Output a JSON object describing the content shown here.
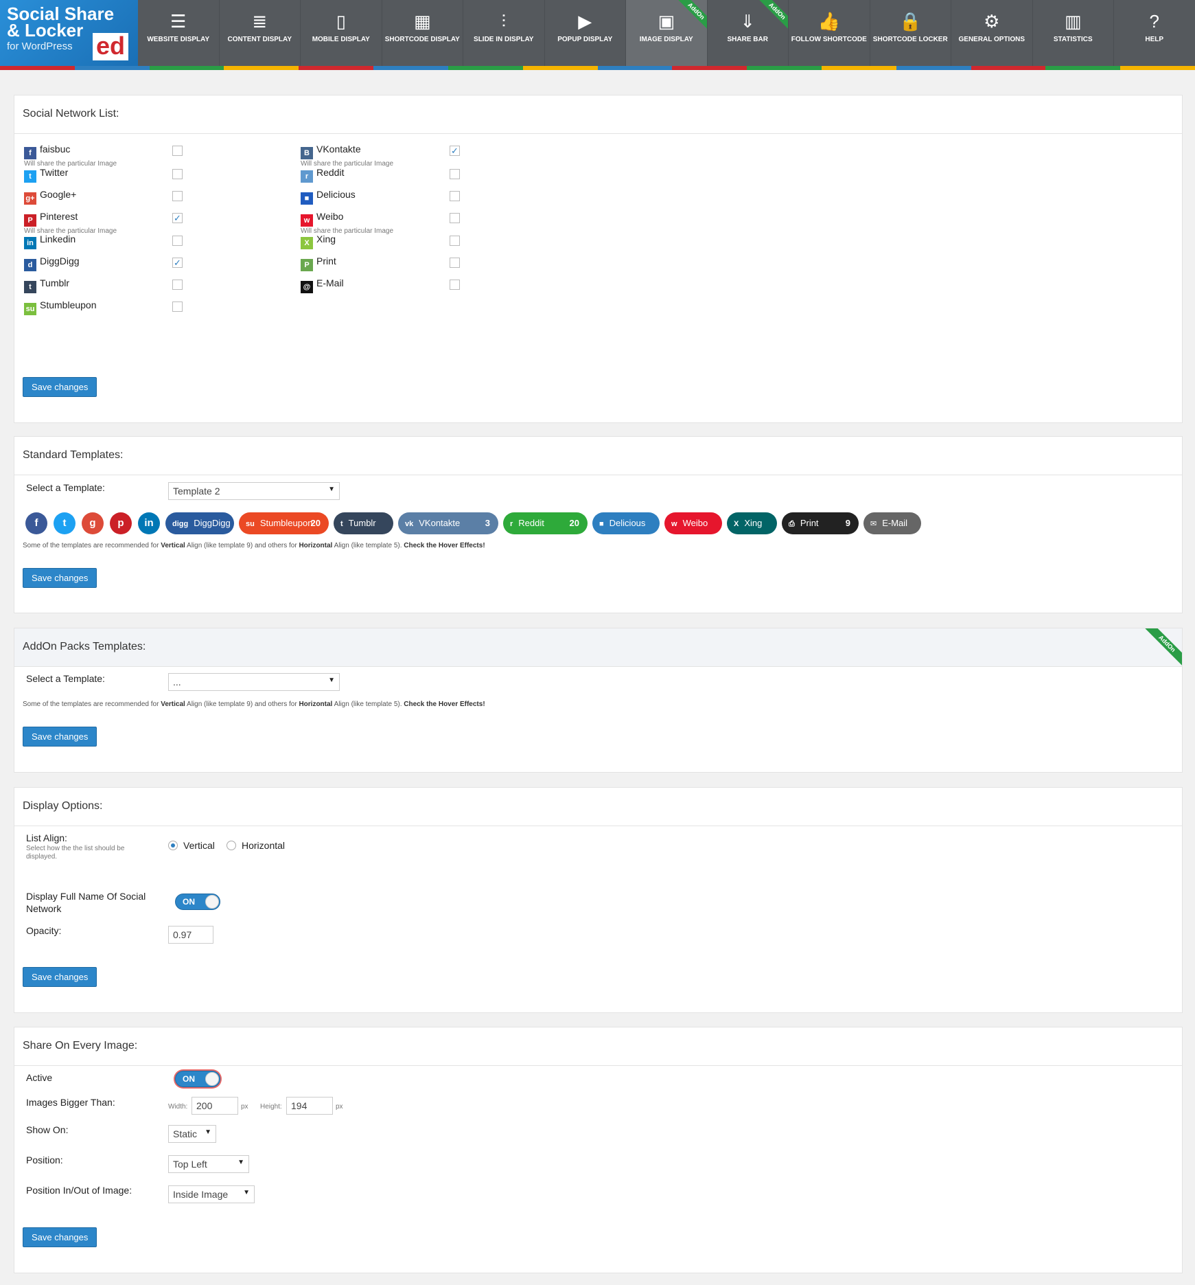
{
  "logo": {
    "line1": "Social Share",
    "line2": "& Locker",
    "line3": "for WordPress",
    "badge": "ed"
  },
  "nav": [
    {
      "icon": "☰",
      "label": "WEBSITE DISPLAY",
      "addon": ""
    },
    {
      "icon": "≣",
      "label": "CONTENT DISPLAY",
      "addon": ""
    },
    {
      "icon": "▯",
      "label": "MOBILE DISPLAY",
      "addon": ""
    },
    {
      "icon": "▦",
      "label": "SHORTCODE DISPLAY",
      "addon": ""
    },
    {
      "icon": "⫶",
      "label": "SLIDE IN DISPLAY",
      "addon": ""
    },
    {
      "icon": "▶",
      "label": "POPUP DISPLAY",
      "addon": ""
    },
    {
      "icon": "▣",
      "label": "IMAGE DISPLAY",
      "addon": "AddOn"
    },
    {
      "icon": "⇓",
      "label": "SHARE BAR",
      "addon": "AddOn"
    },
    {
      "icon": "👍",
      "label": "FOLLOW SHORTCODE",
      "addon": ""
    },
    {
      "icon": "🔒",
      "label": "SHORTCODE LOCKER",
      "addon": ""
    },
    {
      "icon": "⚙",
      "label": "GENERAL OPTIONS",
      "addon": ""
    },
    {
      "icon": "▥",
      "label": "STATISTICS",
      "addon": ""
    },
    {
      "icon": "?",
      "label": "HELP",
      "addon": ""
    }
  ],
  "colors": [
    "#d0282e",
    "#2e7fc0",
    "#2a9d46",
    "#f5b400",
    "#d0282e",
    "#2e7fc0",
    "#2a9d46",
    "#f5b400",
    "#2e7fc0",
    "#d0282e",
    "#2a9d46",
    "#f5b400",
    "#2e7fc0",
    "#d0282e",
    "#2a9d46",
    "#f5b400"
  ],
  "social_list": {
    "title": "Social Network List:",
    "sub_text": "Will share the particular Image",
    "left": [
      {
        "name": "faisbuc",
        "icon": "f",
        "color": "#3b5998",
        "checked": false,
        "sub": true
      },
      {
        "name": "Twitter",
        "icon": "t",
        "color": "#1da1f2",
        "checked": false,
        "sub": false
      },
      {
        "name": "Google+",
        "icon": "g+",
        "color": "#dd4b39",
        "checked": false,
        "sub": false
      },
      {
        "name": "Pinterest",
        "icon": "P",
        "color": "#cb2027",
        "checked": true,
        "sub": true
      },
      {
        "name": "Linkedin",
        "icon": "in",
        "color": "#0077b5",
        "checked": false,
        "sub": false
      },
      {
        "name": "DiggDigg",
        "icon": "d",
        "color": "#2a5b9e",
        "checked": true,
        "sub": false
      },
      {
        "name": "Tumblr",
        "icon": "t",
        "color": "#35465c",
        "checked": false,
        "sub": false
      },
      {
        "name": "Stumbleupon",
        "icon": "su",
        "color": "#7bbf3e",
        "checked": false,
        "sub": false
      }
    ],
    "right": [
      {
        "name": "VKontakte",
        "icon": "B",
        "color": "#45668e",
        "checked": true,
        "sub": true
      },
      {
        "name": "Reddit",
        "icon": "r",
        "color": "#5f99cf",
        "checked": false,
        "sub": false
      },
      {
        "name": "Delicious",
        "icon": "■",
        "color": "#205cc0",
        "checked": false,
        "sub": false
      },
      {
        "name": "Weibo",
        "icon": "w",
        "color": "#e6162d",
        "checked": false,
        "sub": true
      },
      {
        "name": "Xing",
        "icon": "X",
        "color": "#8cc63f",
        "checked": false,
        "sub": false
      },
      {
        "name": "Print",
        "icon": "P",
        "color": "#6aa84f",
        "checked": false,
        "sub": false
      },
      {
        "name": "E-Mail",
        "icon": "@",
        "color": "#111111",
        "checked": false,
        "sub": false
      }
    ],
    "save": "Save changes"
  },
  "standard": {
    "title": "Standard Templates:",
    "label": "Select a Template:",
    "value": "Template 2",
    "circles": [
      {
        "icon": "f",
        "color": "#3b5998"
      },
      {
        "icon": "t",
        "color": "#1da1f2"
      },
      {
        "icon": "g",
        "color": "#dd4b39"
      },
      {
        "icon": "p",
        "color": "#cb2027"
      },
      {
        "icon": "in",
        "color": "#0077b5"
      }
    ],
    "pills": [
      {
        "label": "DiggDigg",
        "icon": "digg",
        "color": "#2a5b9e",
        "count": ""
      },
      {
        "label": "Stumbleupon",
        "icon": "su",
        "color": "#eb4924",
        "count": "20"
      },
      {
        "label": "Tumblr",
        "icon": "t",
        "color": "#35465c",
        "count": ""
      },
      {
        "label": "VKontakte",
        "icon": "vk",
        "color": "#5b7fa6",
        "count": "3"
      },
      {
        "label": "Reddit",
        "icon": "r",
        "color": "#2eaa3a",
        "count": "20"
      },
      {
        "label": "Delicious",
        "icon": "■",
        "color": "#2e7fc0",
        "count": ""
      },
      {
        "label": "Weibo",
        "icon": "w",
        "color": "#e6162d",
        "count": ""
      },
      {
        "label": "Xing",
        "icon": "X",
        "color": "#026466",
        "count": ""
      },
      {
        "label": "Print",
        "icon": "⎙",
        "color": "#222222",
        "count": "9"
      },
      {
        "label": "E-Mail",
        "icon": "✉",
        "color": "#666666",
        "count": ""
      }
    ],
    "note1": "Some of the templates are recommended for ",
    "note_b1": "Vertical",
    "note2": " Align (like template 9) and others for ",
    "note_b2": "Horizontal",
    "note3": " Align (like template 5). ",
    "note_b3": "Check the Hover Effects!",
    "save": "Save changes"
  },
  "addon": {
    "title": "AddOn Packs Templates:",
    "ribbon": "AddOn",
    "label": "Select a Template:",
    "value": "...",
    "save": "Save changes"
  },
  "display": {
    "title": "Display Options:",
    "align_label": "List Align:",
    "align_sub": "Select how the the list should be displayed.",
    "vertical": "Vertical",
    "horizontal": "Horizontal",
    "fullname_label": "Display Full Name Of Social Network",
    "toggle": "ON",
    "opacity_label": "Opacity:",
    "opacity": "0.97",
    "save": "Save changes"
  },
  "share": {
    "title": "Share On Every Image:",
    "active_label": "Active",
    "toggle": "ON",
    "bigger_label": "Images Bigger Than:",
    "width_label": "Width:",
    "width": "200",
    "height_label": "Height:",
    "height": "194",
    "px": "px",
    "show_label": "Show On:",
    "show": "Static",
    "position_label": "Position:",
    "position": "Top Left",
    "inout_label": "Position In/Out of Image:",
    "inout": "Inside Image",
    "save": "Save changes"
  }
}
